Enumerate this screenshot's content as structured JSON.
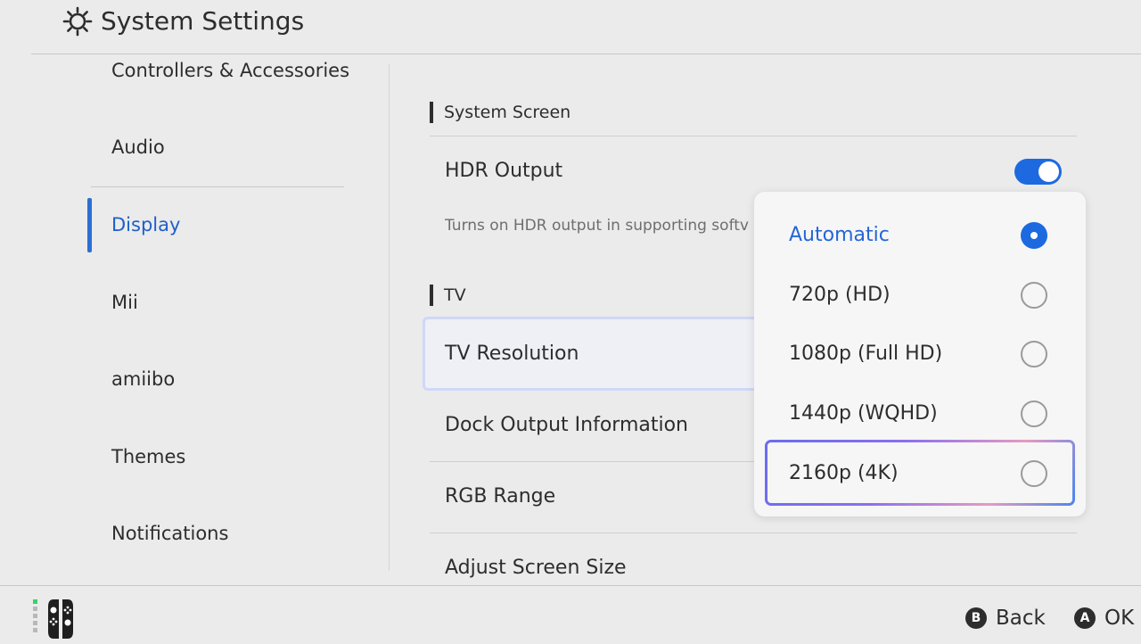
{
  "header": {
    "title": "System Settings",
    "icon": "gear-icon"
  },
  "sidebar": {
    "items": [
      {
        "label": "Controllers & Accessories",
        "active": false
      },
      {
        "label": "Audio",
        "active": false
      },
      {
        "label": "Display",
        "active": true
      },
      {
        "label": "Mii",
        "active": false
      },
      {
        "label": "amiibo",
        "active": false
      },
      {
        "label": "Themes",
        "active": false
      },
      {
        "label": "Notifications",
        "active": false
      }
    ]
  },
  "main": {
    "sections": [
      {
        "label": "System Screen"
      },
      {
        "label": "TV"
      }
    ],
    "hdr_output": {
      "label": "HDR Output",
      "enabled": true,
      "description": "Turns on HDR output in supporting softv"
    },
    "rows": [
      {
        "label": "TV Resolution"
      },
      {
        "label": "Dock Output Information"
      },
      {
        "label": "RGB Range"
      },
      {
        "label": "Adjust Screen Size"
      }
    ]
  },
  "dropdown": {
    "options": [
      {
        "label": "Automatic",
        "selected": true
      },
      {
        "label": "720p (HD)",
        "selected": false
      },
      {
        "label": "1080p (Full HD)",
        "selected": false
      },
      {
        "label": "1440p (WQHD)",
        "selected": false
      },
      {
        "label": "2160p (4K)",
        "selected": false
      }
    ],
    "focused_index": 4
  },
  "footer": {
    "back": {
      "button": "B",
      "label": "Back"
    },
    "ok": {
      "button": "A",
      "label": "OK"
    },
    "controller_icon": "joycon-icon"
  },
  "colors": {
    "accent": "#1d6ae0",
    "active_text": "#1f5fc9",
    "background": "#ebebeb"
  }
}
